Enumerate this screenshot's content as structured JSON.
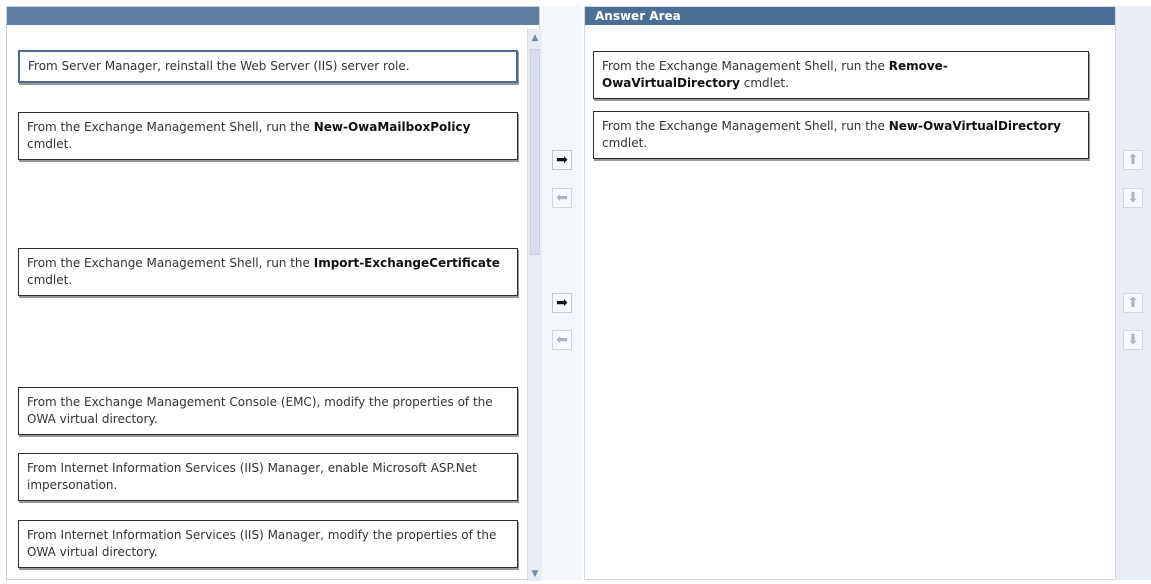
{
  "answer_area": {
    "title": "Answer Area",
    "items": [
      {
        "pre": "From the Exchange Management Shell, run the ",
        "bold": "Remove-OwaVirtualDirectory",
        "post": " cmdlet."
      },
      {
        "pre": "From the Exchange Management Shell, run the ",
        "bold": "New-OwaVirtualDirectory",
        "post": " cmdlet."
      }
    ]
  },
  "options": [
    {
      "pre": "From Server Manager, reinstall the Web Server (IIS) server role.",
      "bold": "",
      "post": ""
    },
    {
      "pre": "From the Exchange Management Shell, run the ",
      "bold": "New-OwaMailboxPolicy",
      "post": " cmdlet."
    },
    {
      "pre": "From the Exchange Management Shell, run the ",
      "bold": "Import-ExchangeCertificate",
      "post": " cmdlet."
    },
    {
      "pre": "From the Exchange Management Console (EMC), modify the properties of the OWA virtual directory.",
      "bold": "",
      "post": ""
    },
    {
      "pre": "From Internet Information Services (IIS) Manager, enable Microsoft ASP.Net impersonation.",
      "bold": "",
      "post": ""
    },
    {
      "pre": "From Internet Information Services (IIS) Manager, modify the properties of the OWA virtual directory.",
      "bold": "",
      "post": ""
    }
  ],
  "icons": {
    "move_right": "arrow-right-icon",
    "move_left": "arrow-left-icon",
    "move_up": "arrow-up-icon",
    "move_down": "arrow-down-icon"
  },
  "colors": {
    "header_blue": "#4b6e96",
    "item_border": "#2b2b2b",
    "disabled_arrow": "#a9b5c4"
  }
}
